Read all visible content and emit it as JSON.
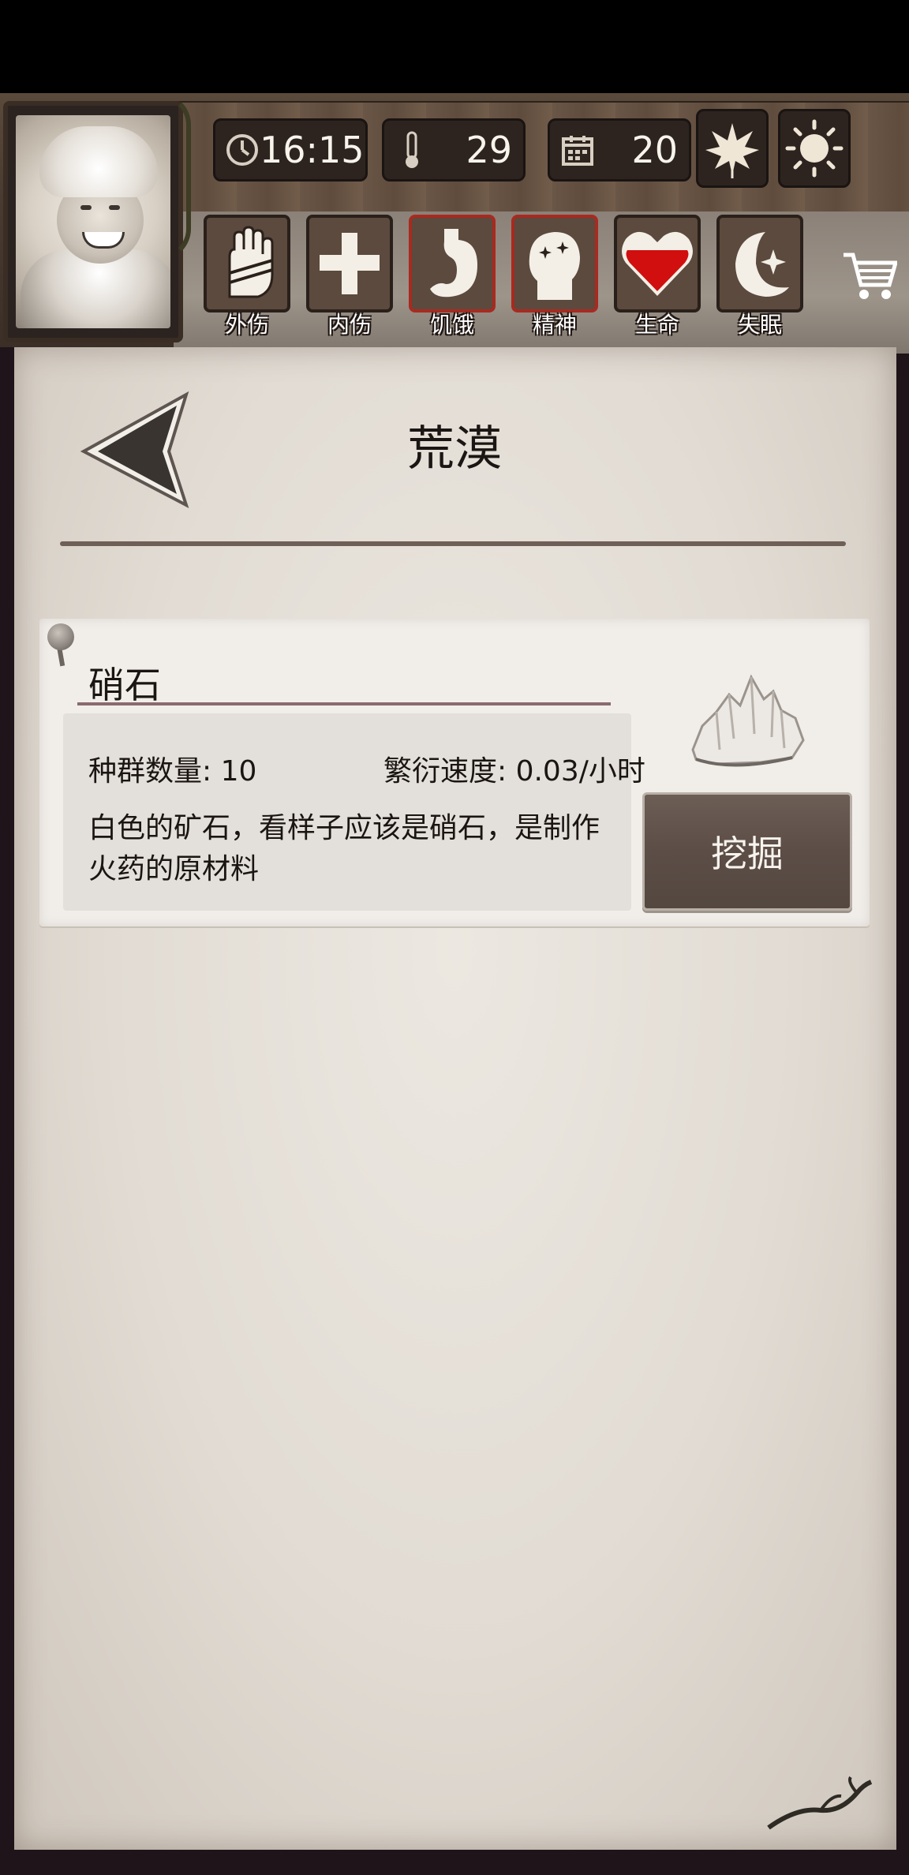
{
  "hud": {
    "time": "16:15",
    "temperature": "29",
    "day": "20",
    "status_icons": [
      {
        "label": "外伤",
        "icon": "hand-bandage-icon"
      },
      {
        "label": "内伤",
        "icon": "cross-icon"
      },
      {
        "label": "饥饿",
        "icon": "stomach-icon"
      },
      {
        "label": "精神",
        "icon": "mind-head-icon"
      },
      {
        "label": "生命",
        "icon": "heart-icon"
      },
      {
        "label": "失眠",
        "icon": "moon-star-icon"
      }
    ],
    "season_icon": "leaf-icon",
    "weather_icon": "sun-icon",
    "shop_icon": "cart-icon"
  },
  "page": {
    "title": "荒漠"
  },
  "resource": {
    "name": "硝石",
    "population_label": "种群数量: 10",
    "growth_label": "繁衍速度: 0.03/小时",
    "description": "白色的矿石，看样子应该是硝石，是制作火药的原材料",
    "action_label": "挖掘"
  }
}
